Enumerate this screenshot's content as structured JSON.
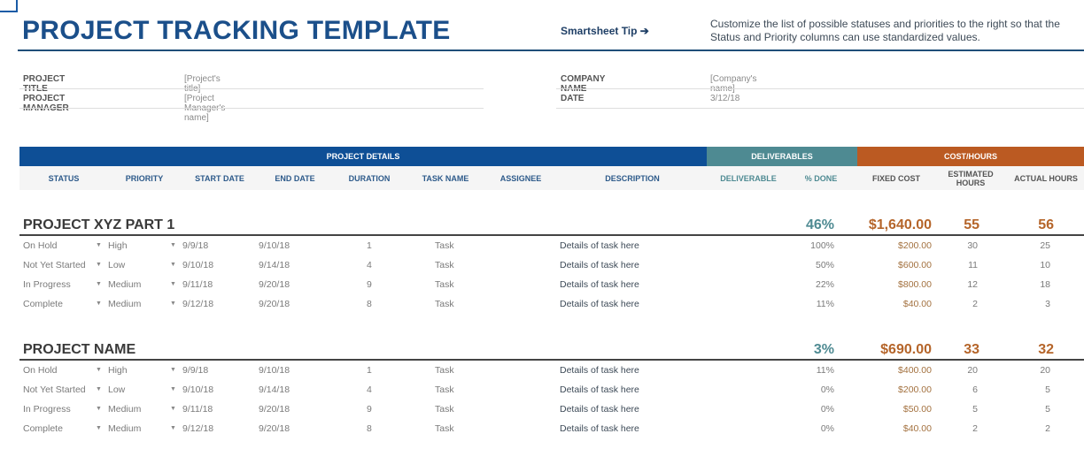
{
  "header": {
    "title": "PROJECT TRACKING TEMPLATE",
    "tip_label": "Smartsheet Tip ➔",
    "tip_text": "Customize the list of possible statuses and priorities to the right so that the Status and Priority columns can use standardized values."
  },
  "meta": {
    "project_title_label": "PROJECT TITLE",
    "project_title_value": "[Project's title]",
    "project_manager_label": "PROJECT MANAGER",
    "project_manager_value": "[Project Manager's name]",
    "company_name_label": "COMPANY NAME",
    "company_name_value": "[Company's name]",
    "date_label": "DATE",
    "date_value": "3/12/18"
  },
  "bands": {
    "details": "PROJECT DETAILS",
    "deliverables": "DELIVERABLES",
    "cost": "COST/HOURS"
  },
  "columns": {
    "status": "STATUS",
    "priority": "PRIORITY",
    "start_date": "START DATE",
    "end_date": "END DATE",
    "duration": "DURATION",
    "task_name": "TASK NAME",
    "assignee": "ASSIGNEE",
    "description": "DESCRIPTION",
    "deliverable": "DELIVERABLE",
    "pct_done": "% DONE",
    "fixed_cost": "FIXED COST",
    "estimated_hours": "ESTIMATED HOURS",
    "actual_hours": "ACTUAL HOURS"
  },
  "icons": {
    "dropdown": "▼"
  },
  "colors": {
    "title_blue": "#1b4f8a",
    "details_band": "#0e4f96",
    "deliverables_band": "#4e8a92",
    "cost_band": "#bb5a22",
    "cost_text": "#b5652a"
  },
  "groups": [
    {
      "name": "PROJECT XYZ PART 1",
      "pct_done": "46%",
      "fixed_cost": "$1,640.00",
      "estimated_hours": "55",
      "actual_hours": "56",
      "rows": [
        {
          "status": "On Hold",
          "priority": "High",
          "start": "9/9/18",
          "end": "9/10/18",
          "duration": "1",
          "task": "Task",
          "assignee": "",
          "description": "Details of task here",
          "deliverable": "",
          "pct": "100%",
          "cost": "$200.00",
          "est": "30",
          "act": "25"
        },
        {
          "status": "Not Yet Started",
          "priority": "Low",
          "start": "9/10/18",
          "end": "9/14/18",
          "duration": "4",
          "task": "Task",
          "assignee": "",
          "description": "Details of task here",
          "deliverable": "",
          "pct": "50%",
          "cost": "$600.00",
          "est": "11",
          "act": "10"
        },
        {
          "status": "In Progress",
          "priority": "Medium",
          "start": "9/11/18",
          "end": "9/20/18",
          "duration": "9",
          "task": "Task",
          "assignee": "",
          "description": "Details of task here",
          "deliverable": "",
          "pct": "22%",
          "cost": "$800.00",
          "est": "12",
          "act": "18"
        },
        {
          "status": "Complete",
          "priority": "Medium",
          "start": "9/12/18",
          "end": "9/20/18",
          "duration": "8",
          "task": "Task",
          "assignee": "",
          "description": "Details of task here",
          "deliverable": "",
          "pct": "11%",
          "cost": "$40.00",
          "est": "2",
          "act": "3"
        }
      ]
    },
    {
      "name": "PROJECT NAME",
      "pct_done": "3%",
      "fixed_cost": "$690.00",
      "estimated_hours": "33",
      "actual_hours": "32",
      "rows": [
        {
          "status": "On Hold",
          "priority": "High",
          "start": "9/9/18",
          "end": "9/10/18",
          "duration": "1",
          "task": "Task",
          "assignee": "",
          "description": "Details of task here",
          "deliverable": "",
          "pct": "11%",
          "cost": "$400.00",
          "est": "20",
          "act": "20"
        },
        {
          "status": "Not Yet Started",
          "priority": "Low",
          "start": "9/10/18",
          "end": "9/14/18",
          "duration": "4",
          "task": "Task",
          "assignee": "",
          "description": "Details of task here",
          "deliverable": "",
          "pct": "0%",
          "cost": "$200.00",
          "est": "6",
          "act": "5"
        },
        {
          "status": "In Progress",
          "priority": "Medium",
          "start": "9/11/18",
          "end": "9/20/18",
          "duration": "9",
          "task": "Task",
          "assignee": "",
          "description": "Details of task here",
          "deliverable": "",
          "pct": "0%",
          "cost": "$50.00",
          "est": "5",
          "act": "5"
        },
        {
          "status": "Complete",
          "priority": "Medium",
          "start": "9/12/18",
          "end": "9/20/18",
          "duration": "8",
          "task": "Task",
          "assignee": "",
          "description": "Details of task here",
          "deliverable": "",
          "pct": "0%",
          "cost": "$40.00",
          "est": "2",
          "act": "2"
        }
      ]
    }
  ]
}
